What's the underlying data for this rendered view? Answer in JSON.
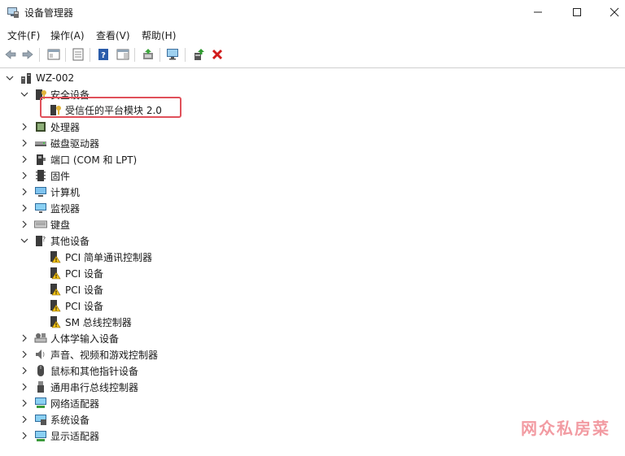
{
  "window": {
    "title": "设备管理器"
  },
  "menu": [
    "文件(F)",
    "操作(A)",
    "查看(V)",
    "帮助(H)"
  ],
  "toolbar": {
    "icons": [
      "back-arrow-icon",
      "forward-arrow-icon",
      "show-hide-tree-icon",
      "properties-icon",
      "help-icon",
      "action-pane-icon",
      "update-driver-icon",
      "scan-hardware-icon",
      "enable-device-icon",
      "uninstall-device-icon"
    ],
    "uninstall_color": "#d11a1a"
  },
  "tree": {
    "root": "WZ-002",
    "items": [
      {
        "label": "安全设备",
        "expanded": true,
        "icon": "security-device-icon"
      },
      {
        "label": "受信任的平台模块 2.0",
        "child": true,
        "icon": "tpm-key-icon"
      },
      {
        "label": "处理器",
        "icon": "processor-icon"
      },
      {
        "label": "磁盘驱动器",
        "icon": "disk-drive-icon"
      },
      {
        "label": "端口 (COM 和 LPT)",
        "icon": "port-icon"
      },
      {
        "label": "固件",
        "icon": "firmware-icon"
      },
      {
        "label": "计算机",
        "icon": "computer-icon"
      },
      {
        "label": "监视器",
        "icon": "monitor-icon"
      },
      {
        "label": "键盘",
        "icon": "keyboard-icon"
      },
      {
        "label": "其他设备",
        "expanded": true,
        "icon": "other-devices-icon"
      },
      {
        "label": "PCI 简单通讯控制器",
        "child": true,
        "icon": "warning-device-icon"
      },
      {
        "label": "PCI 设备",
        "child": true,
        "icon": "warning-device-icon"
      },
      {
        "label": "PCI 设备",
        "child": true,
        "icon": "warning-device-icon"
      },
      {
        "label": "PCI 设备",
        "child": true,
        "icon": "warning-device-icon"
      },
      {
        "label": "SM 总线控制器",
        "child": true,
        "icon": "warning-device-icon"
      },
      {
        "label": "人体学输入设备",
        "icon": "hid-icon"
      },
      {
        "label": "声音、视频和游戏控制器",
        "icon": "sound-icon"
      },
      {
        "label": "鼠标和其他指针设备",
        "icon": "mouse-icon"
      },
      {
        "label": "通用串行总线控制器",
        "icon": "usb-icon"
      },
      {
        "label": "网络适配器",
        "icon": "network-adapter-icon"
      },
      {
        "label": "系统设备",
        "icon": "system-device-icon"
      },
      {
        "label": "显示适配器",
        "icon": "display-adapter-icon"
      }
    ]
  },
  "highlight_color": "#e0505a",
  "watermark": "网众私房菜"
}
